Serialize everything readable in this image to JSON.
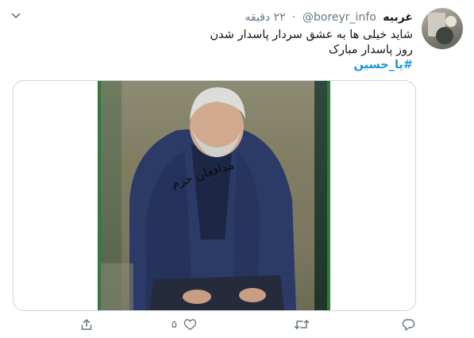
{
  "tweet": {
    "display_name": "غربیه",
    "handle": "@boreyr_info",
    "separator": "·",
    "time": "۲۲ دقیقه",
    "text_line1": "شاید خیلی ها به عشق سردار پاسدار شدن",
    "text_line2": "روز پاسدار مبارک",
    "hashtag": "#یا_حسین",
    "image_signature": "مدافعان حرم"
  },
  "actions": {
    "like_count": "۵"
  },
  "icons": [
    "chevron-down-icon",
    "share-icon",
    "like-icon",
    "retweet-icon",
    "reply-icon"
  ],
  "colors": {
    "hashtag": "#1b95e0",
    "secondary_text": "#657786",
    "border": "#ccd6dd"
  }
}
